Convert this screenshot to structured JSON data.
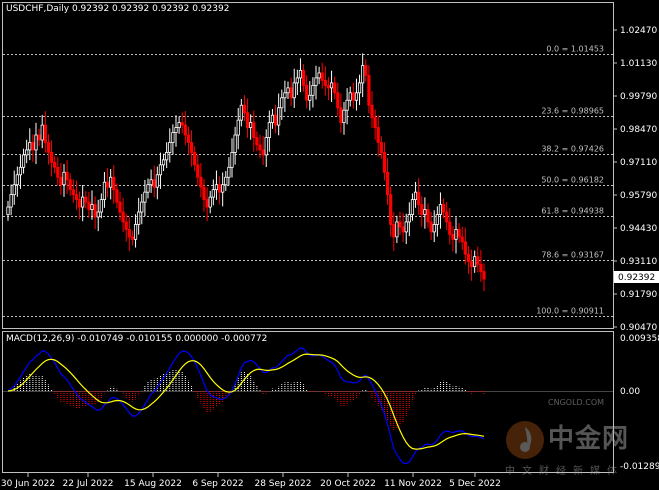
{
  "header": {
    "instrument": "USDCHF,Daily",
    "ohlc": "0.92392 0.92392 0.92392 0.92392"
  },
  "macd": {
    "title": "MACD(12,26,9) -0.010749 -0.010155 0.000000 -0.000772",
    "scale": [
      "0.009358",
      "0.00",
      "-0.012897"
    ]
  },
  "price_axis": [
    "1.02470",
    "1.01130",
    "0.99790",
    "0.98470",
    "0.97110",
    "0.95790",
    "0.94430",
    "0.93110",
    "0.91790",
    "0.90470"
  ],
  "current_price": "0.92392",
  "fib_levels": [
    {
      "label": "0.0 = 1.01453",
      "price": 1.01453
    },
    {
      "label": "23.6 = 0.98965",
      "price": 0.98965
    },
    {
      "label": "38.2 = 0.97426",
      "price": 0.97426
    },
    {
      "label": "50.0 = 0.96182",
      "price": 0.96182
    },
    {
      "label": "61.8 = 0.94938",
      "price": 0.94938
    },
    {
      "label": "78.6 = 0.93167",
      "price": 0.93167
    },
    {
      "label": "100.0 = 0.90911",
      "price": 0.90911
    }
  ],
  "date_axis": [
    "30 Jun 2022",
    "22 Jul 2022",
    "15 Aug 2022",
    "6 Sep 2022",
    "28 Sep 2022",
    "20 Oct 2022",
    "11 Nov 2022",
    "5 Dec 2022"
  ],
  "watermark": {
    "brand": "中金网",
    "url": "CNGOLD.COM",
    "sub": "中文财经新媒体"
  },
  "colors": {
    "bull": "#ffffff",
    "bear": "#ff0000",
    "grid": "#c0c0c0",
    "macd_line": "#0000ff",
    "signal_line": "#ffff00"
  },
  "chart_data": {
    "type": "candlestick",
    "closes": [
      0.953,
      0.958,
      0.962,
      0.966,
      0.969,
      0.974,
      0.976,
      0.979,
      0.976,
      0.982,
      0.98,
      0.986,
      0.979,
      0.975,
      0.971,
      0.969,
      0.965,
      0.962,
      0.967,
      0.964,
      0.96,
      0.958,
      0.956,
      0.953,
      0.957,
      0.955,
      0.952,
      0.954,
      0.949,
      0.951,
      0.956,
      0.963,
      0.961,
      0.965,
      0.96,
      0.955,
      0.951,
      0.947,
      0.944,
      0.941,
      0.94,
      0.946,
      0.951,
      0.955,
      0.959,
      0.962,
      0.964,
      0.961,
      0.966,
      0.97,
      0.972,
      0.975,
      0.979,
      0.983,
      0.985,
      0.987,
      0.986,
      0.982,
      0.979,
      0.975,
      0.97,
      0.965,
      0.961,
      0.956,
      0.953,
      0.957,
      0.96,
      0.962,
      0.959,
      0.962,
      0.965,
      0.969,
      0.975,
      0.982,
      0.988,
      0.994,
      0.991,
      0.985,
      0.987,
      0.981,
      0.978,
      0.976,
      0.974,
      0.981,
      0.987,
      0.99,
      0.986,
      0.993,
      0.997,
      0.999,
      1.001,
      0.997,
      1.003,
      1.005,
      1.008,
      1.002,
      0.996,
      0.998,
      1.002,
      1.005,
      1.007,
      1.004,
      1.002,
      1.001,
      1.003,
      0.999,
      0.993,
      0.987,
      0.992,
      0.996,
      0.999,
      0.996,
      0.999,
      1.003,
      1.01,
      1.006,
      0.994,
      0.989,
      0.985,
      0.979,
      0.975,
      0.967,
      0.958,
      0.946,
      0.941,
      0.947,
      0.945,
      0.943,
      0.947,
      0.95,
      0.956,
      0.959,
      0.954,
      0.95,
      0.952,
      0.947,
      0.943,
      0.946,
      0.95,
      0.954,
      0.951,
      0.947,
      0.942,
      0.94,
      0.944,
      0.941,
      0.939,
      0.934,
      0.931,
      0.929,
      0.933,
      0.93,
      0.927,
      0.924
    ],
    "y_range": [
      0.9047,
      1.0247
    ],
    "x_labels": [
      "30 Jun 2022",
      "22 Jul 2022",
      "15 Aug 2022",
      "6 Sep 2022",
      "28 Sep 2022",
      "20 Oct 2022",
      "11 Nov 2022",
      "5 Dec 2022"
    ],
    "macd_range": [
      -0.012897,
      0.009358
    ]
  }
}
